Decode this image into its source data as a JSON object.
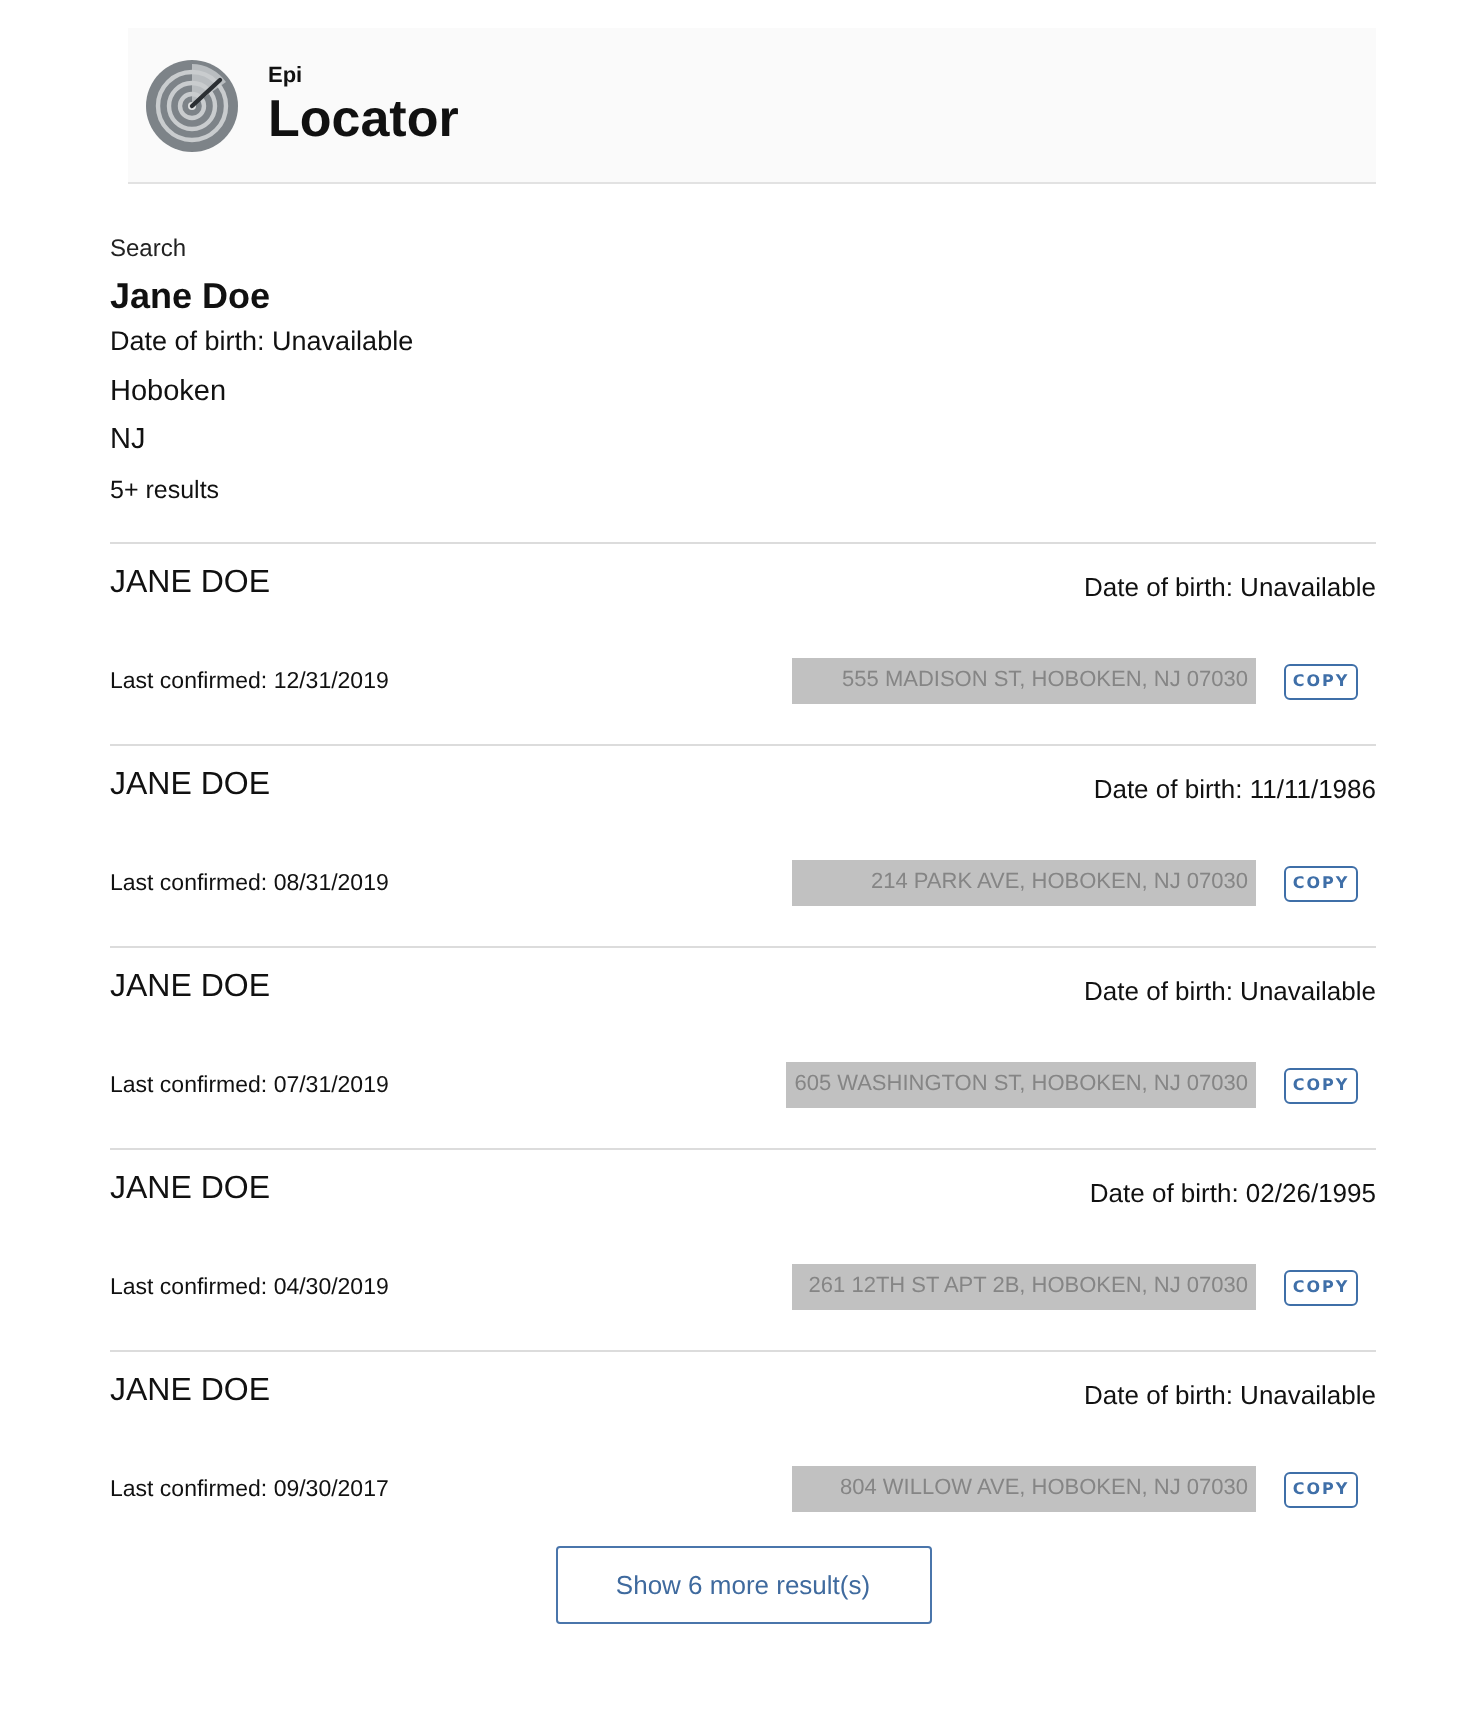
{
  "header": {
    "brand_small": "Epi",
    "brand_title": "Locator"
  },
  "search": {
    "label": "Search",
    "name": "Jane Doe",
    "date_of_birth": "Date of birth: Unavailable",
    "city": "Hoboken",
    "state": "NJ",
    "result_count": "5+ results"
  },
  "results": [
    {
      "name": "JANE DOE",
      "date_of_birth": "Date of birth: Unavailable",
      "last_confirmed": "Last confirmed: 12/31/2019",
      "address": "555 MADISON ST, HOBOKEN, NJ 07030",
      "copy_button": "COPY"
    },
    {
      "name": "JANE DOE",
      "date_of_birth": "Date of birth: 11/11/1986",
      "last_confirmed": "Last confirmed: 08/31/2019",
      "address": "214 PARK AVE, HOBOKEN, NJ 07030",
      "copy_button": "COPY"
    },
    {
      "name": "JANE DOE",
      "date_of_birth": "Date of birth: Unavailable",
      "last_confirmed": "Last confirmed: 07/31/2019",
      "address": "605 WASHINGTON ST, HOBOKEN, NJ 07030",
      "copy_button": "COPY"
    },
    {
      "name": "JANE DOE",
      "date_of_birth": "Date of birth: 02/26/1995",
      "last_confirmed": "Last confirmed: 04/30/2019",
      "address": "261 12TH ST APT 2B, HOBOKEN, NJ 07030",
      "copy_button": "COPY"
    },
    {
      "name": "JANE DOE",
      "date_of_birth": "Date of birth: Unavailable",
      "last_confirmed": "Last confirmed: 09/30/2017",
      "address": "804 WILLOW AVE, HOBOKEN, NJ 07030",
      "copy_button": "COPY"
    }
  ],
  "more_button": "Show 6 more result(s)"
}
